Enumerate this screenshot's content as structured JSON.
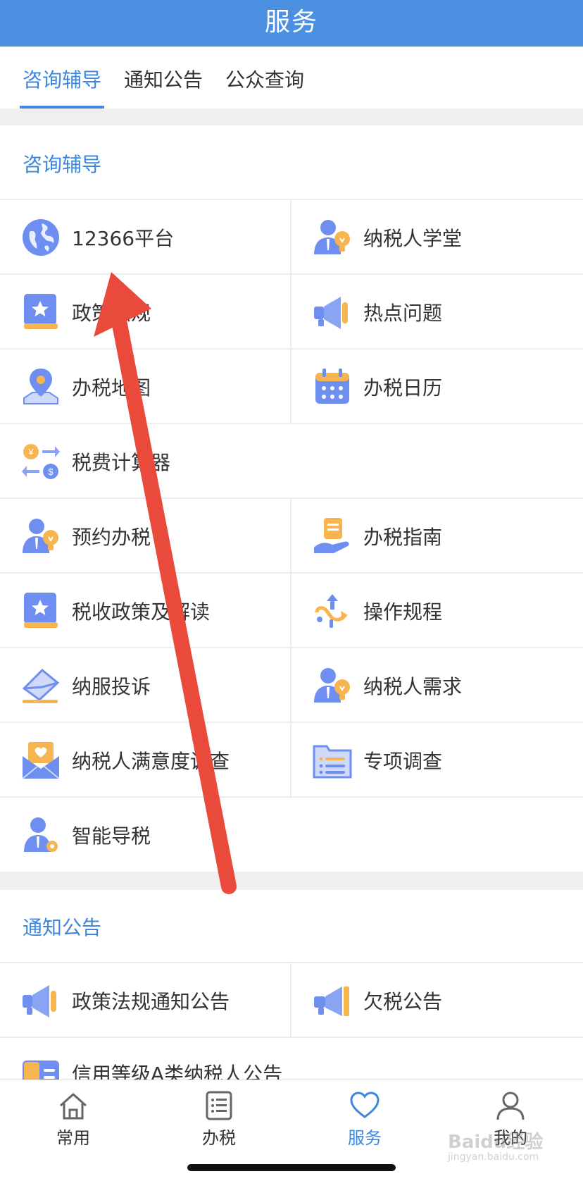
{
  "header": {
    "title": "服务"
  },
  "tabs": [
    {
      "label": "咨询辅导"
    },
    {
      "label": "通知公告"
    },
    {
      "label": "公众查询"
    }
  ],
  "consult": {
    "title": "咨询辅导",
    "items": [
      {
        "label": "12366平台",
        "icon": "globe-icon"
      },
      {
        "label": "纳税人学堂",
        "icon": "person-bulb-icon"
      },
      {
        "label": "政策法规",
        "icon": "star-book-icon"
      },
      {
        "label": "热点问题",
        "icon": "megaphone-icon"
      },
      {
        "label": "办税地图",
        "icon": "map-pin-icon"
      },
      {
        "label": "办税日历",
        "icon": "calendar-icon"
      },
      {
        "label": "税费计算器",
        "icon": "currency-exchange-icon"
      },
      {
        "label": "预约办税",
        "icon": "person-bulb-icon"
      },
      {
        "label": "办税指南",
        "icon": "hand-clipboard-icon"
      },
      {
        "label": "税收政策及解读",
        "icon": "star-book-icon"
      },
      {
        "label": "操作规程",
        "icon": "flow-arrow-icon"
      },
      {
        "label": "纳服投诉",
        "icon": "envelope-send-icon"
      },
      {
        "label": "纳税人需求",
        "icon": "person-bulb-icon"
      },
      {
        "label": "纳税人满意度调查",
        "icon": "heart-envelope-icon"
      },
      {
        "label": "专项调查",
        "icon": "folder-list-icon"
      },
      {
        "label": "智能导税",
        "icon": "person-gear-icon"
      }
    ]
  },
  "notice": {
    "title": "通知公告",
    "items": [
      {
        "label": "政策法规通知公告",
        "icon": "megaphone-icon"
      },
      {
        "label": "欠税公告",
        "icon": "megaphone-icon"
      },
      {
        "label": "信用等级A类纳税人公告",
        "icon": "credit-doc-icon",
        "icon_text": "信"
      }
    ]
  },
  "bottom_nav": [
    {
      "label": "常用",
      "icon": "home-icon"
    },
    {
      "label": "办税",
      "icon": "list-icon"
    },
    {
      "label": "服务",
      "icon": "heart-icon",
      "active": true
    },
    {
      "label": "我的",
      "icon": "user-icon"
    }
  ],
  "watermark": {
    "text": "Baidu经验",
    "sub": "jingyan.baidu.com"
  },
  "colors": {
    "header": "#4a8fe0",
    "accent": "#3d86dd",
    "arrow": "#e94a3c",
    "icon_blue": "#6f8ff0",
    "icon_orange": "#f7b552"
  }
}
